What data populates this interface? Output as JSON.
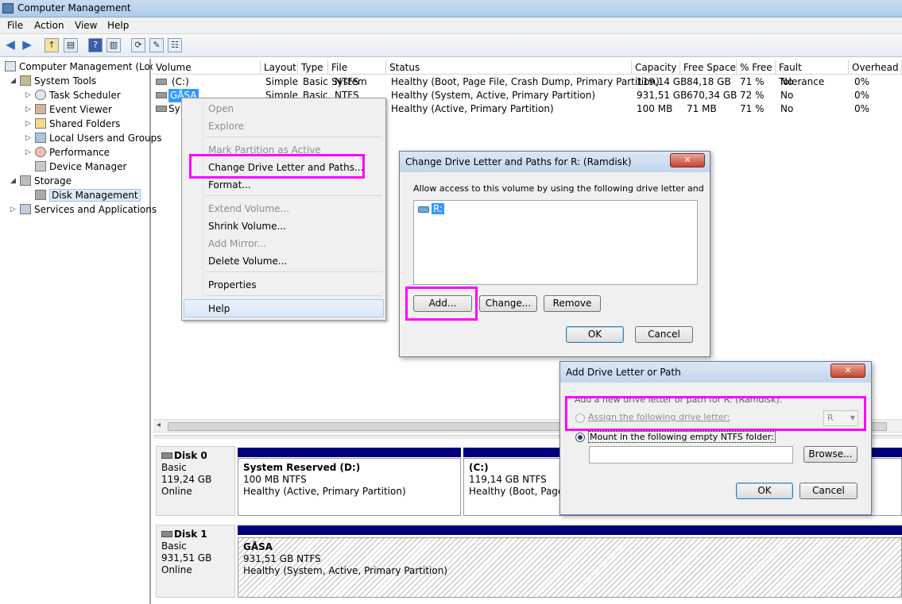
{
  "window": {
    "title": "Computer Management"
  },
  "menu": [
    "File",
    "Action",
    "View",
    "Help"
  ],
  "tree": {
    "root": "Computer Management (Local",
    "system_tools": "System Tools",
    "task_scheduler": "Task Scheduler",
    "event_viewer": "Event Viewer",
    "shared_folders": "Shared Folders",
    "local_users": "Local Users and Groups",
    "performance": "Performance",
    "device_manager": "Device Manager",
    "storage": "Storage",
    "disk_management": "Disk Management",
    "services": "Services and Applications"
  },
  "volume_list": {
    "columns": [
      "Volume",
      "Layout",
      "Type",
      "File System",
      "Status",
      "Capacity",
      "Free Space",
      "% Free",
      "Fault Tolerance",
      "Overhead"
    ],
    "rows": [
      [
        "(C:)",
        "Simple",
        "Basic",
        "NTFS",
        "Healthy (Boot, Page File, Crash Dump, Primary Partition)",
        "119,14 GB",
        "84,18 GB",
        "71 %",
        "No",
        "0%"
      ],
      [
        "GÅSA",
        "Simple",
        "Basic",
        "NTFS",
        "Healthy (System, Active, Primary Partition)",
        "931,51 GB",
        "670,34 GB",
        "72 %",
        "No",
        "0%"
      ],
      [
        "Sy",
        "",
        "",
        "",
        "Healthy (Active, Primary Partition)",
        "100 MB",
        "71 MB",
        "71 %",
        "No",
        "0%"
      ]
    ]
  },
  "context_menu": {
    "open": "Open",
    "explore": "Explore",
    "mark_active": "Mark Partition as Active",
    "change_letter": "Change Drive Letter and Paths...",
    "format": "Format...",
    "extend": "Extend Volume...",
    "shrink": "Shrink Volume...",
    "add_mirror": "Add Mirror...",
    "delete": "Delete Volume...",
    "properties": "Properties",
    "help": "Help"
  },
  "disks": {
    "disk0": {
      "name": "Disk 0",
      "type": "Basic",
      "size": "119,24 GB",
      "status": "Online",
      "p1": {
        "name": "System Reserved  (D:)",
        "size": "100 MB NTFS",
        "status": "Healthy (Active, Primary Partition)"
      },
      "p2": {
        "name": "(C:)",
        "size": "119,14 GB NTFS",
        "status": "Healthy (Boot, Page F"
      }
    },
    "disk1": {
      "name": "Disk 1",
      "type": "Basic",
      "size": "931,51 GB",
      "status": "Online",
      "p1": {
        "name": "GÅSA",
        "size": "931,51 GB NTFS",
        "status": "Healthy (System, Active, Primary Partition)"
      }
    }
  },
  "change_dialog": {
    "title": "Change Drive Letter and Paths for R: (Ramdisk)",
    "instruction": "Allow access to this volume by using the following drive letter and",
    "entry": "R:",
    "add": "Add...",
    "change": "Change...",
    "remove": "Remove",
    "ok": "OK",
    "cancel": "Cancel"
  },
  "add_dialog": {
    "title": "Add Drive Letter or Path",
    "instruction": "Add a new drive letter or path for R: (Ramdisk).",
    "assign_label": "Assign the following drive letter:",
    "letter": "R",
    "mount_label": "Mount in the following empty NTFS folder:",
    "browse": "Browse...",
    "ok": "OK",
    "cancel": "Cancel"
  },
  "colors": {
    "highlight": "#ff00ff",
    "partition_bar": "#00007a"
  }
}
